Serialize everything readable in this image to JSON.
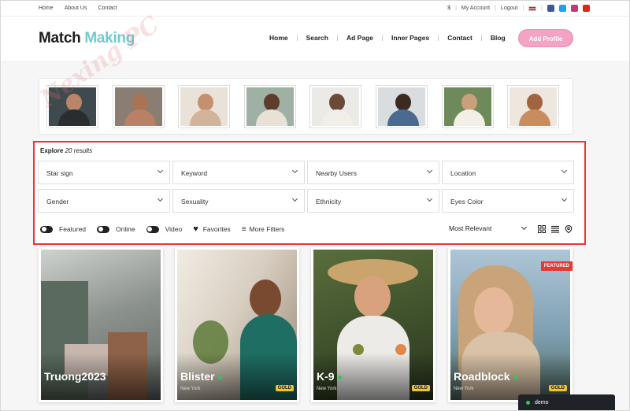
{
  "topbar": {
    "links": [
      "Home",
      "About Us",
      "Contact"
    ],
    "currency": "$",
    "my_account": "My Account",
    "logout": "Logout"
  },
  "header": {
    "logo_part1": "Match",
    "logo_part2": "Making",
    "nav": [
      "Home",
      "Search",
      "Ad Page",
      "Inner Pages",
      "Contact",
      "Blog"
    ],
    "add_profile": "Add Profile"
  },
  "watermark": "Nexing PC",
  "filters": {
    "explore_label": "Explore",
    "results": "20 results",
    "selects_row1": [
      "Star sign",
      "Keyword",
      "Nearby Users",
      "Location"
    ],
    "selects_row2": [
      "Gender",
      "Sexuality",
      "Ethnicity",
      "Eyes Color"
    ],
    "toggle_featured": "Featured",
    "toggle_online": "Online",
    "toggle_video": "Video",
    "favorites": "Favorites",
    "more_filters": "More Filters",
    "sort": "Most Relevant"
  },
  "cards": [
    {
      "name": "Truong2023",
      "location": "",
      "badge": "",
      "featured": ""
    },
    {
      "name": "Blister",
      "location": "New York",
      "badge": "GOLD",
      "featured": ""
    },
    {
      "name": "K-9",
      "location": "New York",
      "badge": "GOLD",
      "featured": ""
    },
    {
      "name": "Roadblock",
      "location": "New York",
      "badge": "GOLD",
      "featured": "FEATURED"
    }
  ],
  "demo_label": "demo",
  "colors": {
    "accent_pink": "#f3a3c4",
    "logo_teal": "#6ecbd0",
    "highlight_red": "#e53935",
    "gold": "#f2c230",
    "online_green": "#35c45a"
  }
}
